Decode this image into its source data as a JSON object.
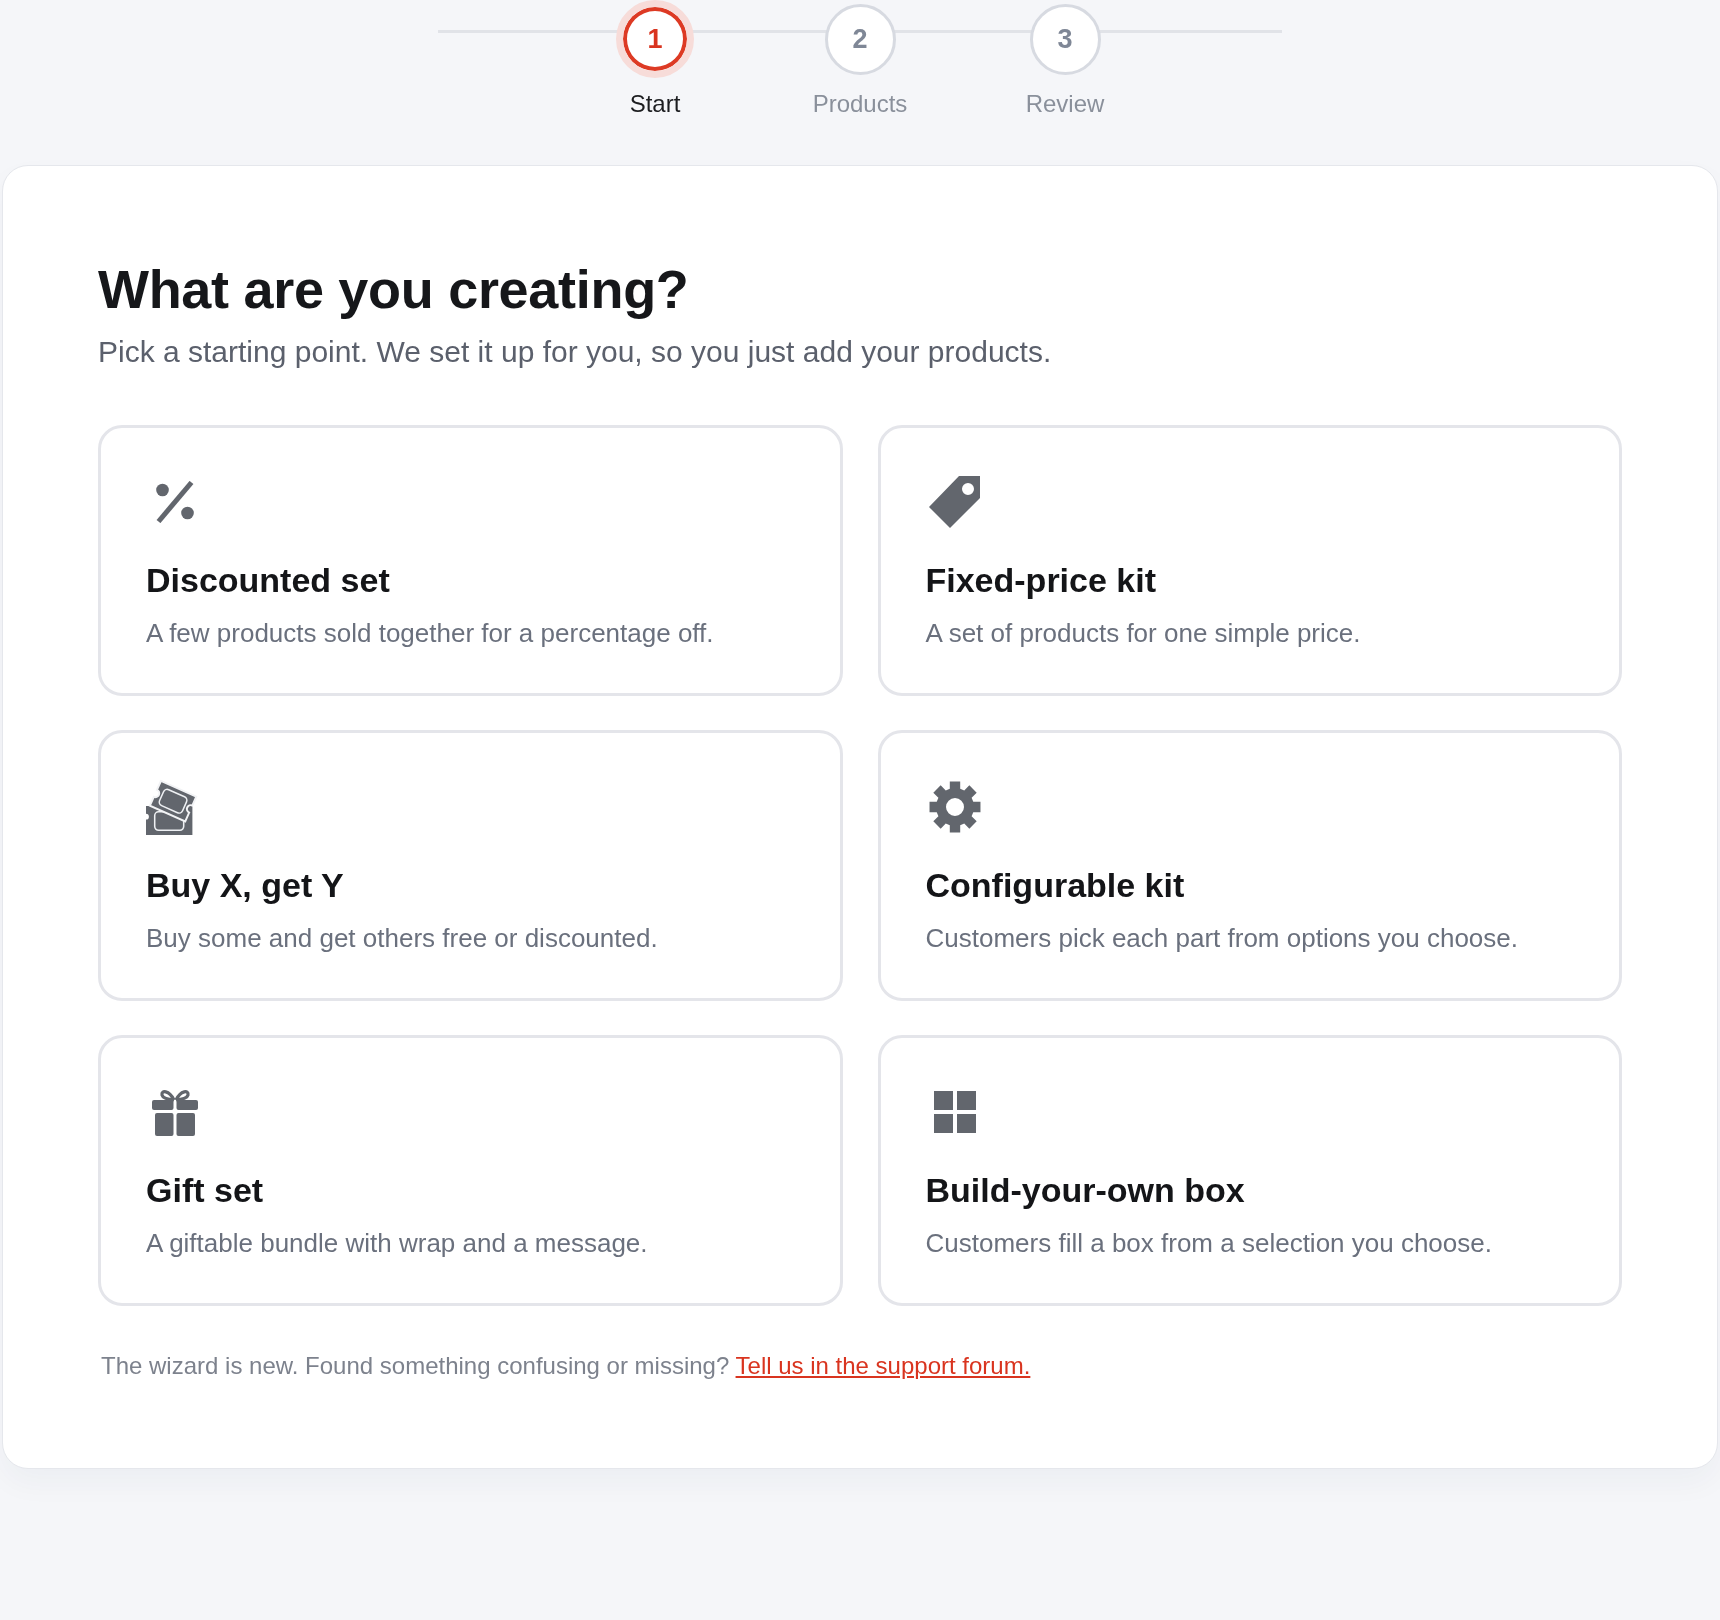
{
  "stepper": {
    "steps": [
      {
        "number": "1",
        "label": "Start",
        "selected": true
      },
      {
        "number": "2",
        "label": "Products",
        "selected": false
      },
      {
        "number": "3",
        "label": "Review",
        "selected": false
      }
    ]
  },
  "heading": {
    "title": "What are you creating?",
    "subtitle": "Pick a starting point. We set it up for you, so you just add your products."
  },
  "options": [
    {
      "title": "Discounted set",
      "description": "A few products sold together for a percentage off."
    },
    {
      "title": "Fixed-price kit",
      "description": "A set of products for one simple price."
    },
    {
      "title": "Buy X, get Y",
      "description": "Buy some and get others free or discounted."
    },
    {
      "title": "Configurable kit",
      "description": "Customers pick each part from options you choose."
    },
    {
      "title": "Gift set",
      "description": "A giftable bundle with wrap and a message."
    },
    {
      "title": "Build-your-own box",
      "description": "Customers fill a box from a selection you choose."
    }
  ],
  "footer": {
    "text": "The wizard is new. Found something confusing or missing?",
    "link": "Tell us in the support forum."
  }
}
